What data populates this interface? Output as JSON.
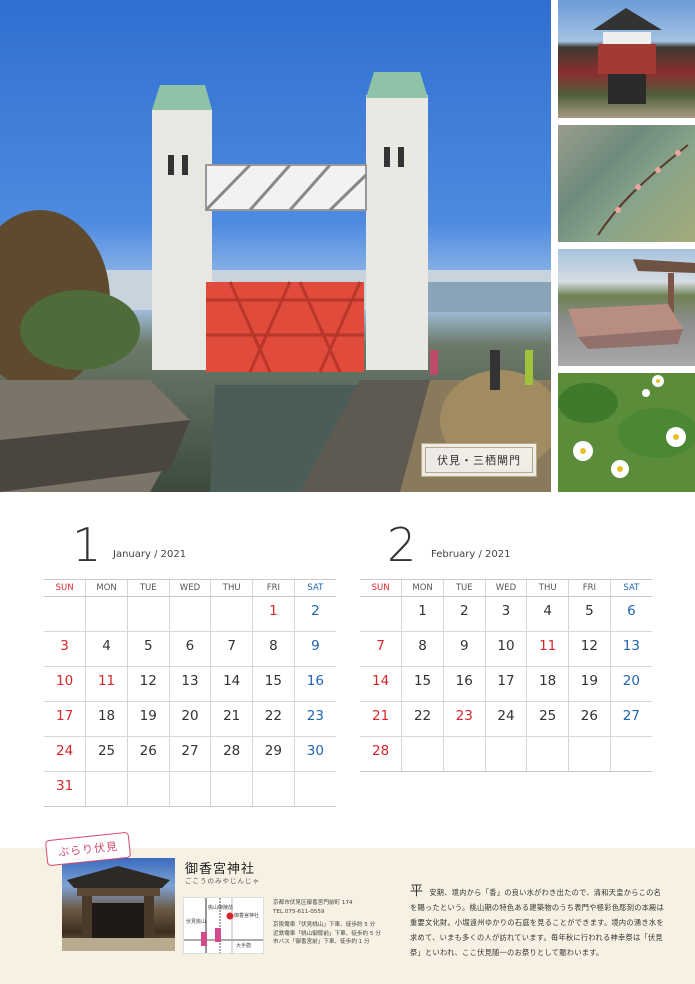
{
  "photos": {
    "caption": "伏見・三栖閘門"
  },
  "calendar": {
    "weekdays": [
      "SUN",
      "MON",
      "TUE",
      "WED",
      "THU",
      "FRI",
      "SAT"
    ],
    "months": [
      {
        "number": "1",
        "name": "January / 2021",
        "weeks": [
          [
            "",
            "",
            "",
            "",
            "",
            "1",
            "2"
          ],
          [
            "3",
            "4",
            "5",
            "6",
            "7",
            "8",
            "9"
          ],
          [
            "10",
            "11",
            "12",
            "13",
            "14",
            "15",
            "16"
          ],
          [
            "17",
            "18",
            "19",
            "20",
            "21",
            "22",
            "23"
          ],
          [
            "24",
            "25",
            "26",
            "27",
            "28",
            "29",
            "30"
          ],
          [
            "31",
            "",
            "",
            "",
            "",
            "",
            ""
          ]
        ],
        "holidays": [
          "1",
          "11"
        ]
      },
      {
        "number": "2",
        "name": "February / 2021",
        "weeks": [
          [
            "",
            "1",
            "2",
            "3",
            "4",
            "5",
            "6"
          ],
          [
            "7",
            "8",
            "9",
            "10",
            "11",
            "12",
            "13"
          ],
          [
            "14",
            "15",
            "16",
            "17",
            "18",
            "19",
            "20"
          ],
          [
            "21",
            "22",
            "23",
            "24",
            "25",
            "26",
            "27"
          ],
          [
            "28",
            "",
            "",
            "",
            "",
            "",
            ""
          ]
        ],
        "holidays": [
          "11",
          "23"
        ]
      }
    ]
  },
  "footer": {
    "stamp": "ぶらり伏見",
    "shrine_name": "御香宮神社",
    "shrine_reading": "ごこうのみやじんじゃ",
    "address": "京都市伏見区御香宮門前町 174",
    "tel": "TEL.075-611-0559",
    "access": [
      "京阪電車「伏見桃山」下車、徒歩約 5 分",
      "近鉄電車「桃山御陵前」下車、徒歩約 5 分",
      "市バス「御香宮前」下車、徒歩約 1 分"
    ],
    "map_labels": {
      "station1": "伏見桃山",
      "station2": "桃山御陵前",
      "road": "大手筋",
      "marker": "御香宮神社"
    },
    "initial": "平",
    "body": "安期、境内から「香」の良い水がわき出たので、清和天皇からこの名を賜ったという。桃山期の特色ある建築物のうち表門や極彩色彫刻の本殿は重要文化財。小堀遠州ゆかりの石庭を見ることができます。境内の湧き水を求めて、いまも多くの人が訪れています。毎年秋に行われる神幸祭は「伏見祭」といわれ、ここ伏見随一のお祭りとして賑わいます。"
  }
}
